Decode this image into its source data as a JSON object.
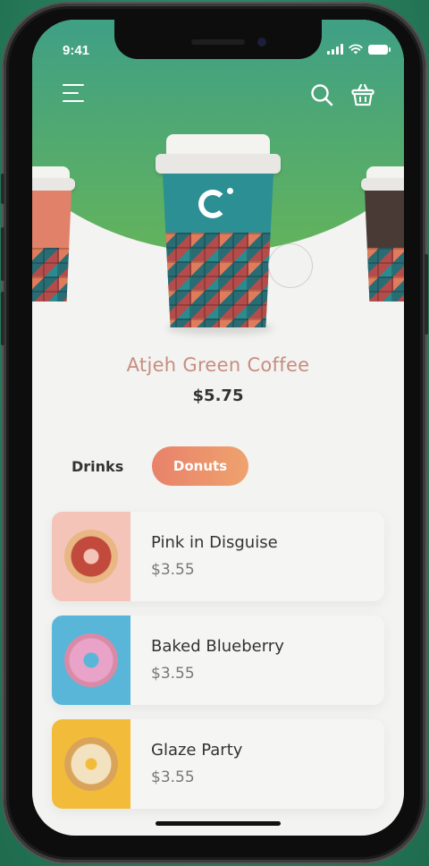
{
  "status_bar": {
    "time": "9:41"
  },
  "header": {
    "menu_icon": "menu-icon",
    "search_icon": "search-icon",
    "cart_icon": "basket-icon"
  },
  "featured": {
    "name": "Atjeh Green Coffee",
    "price": "$5.75"
  },
  "tabs": [
    {
      "label": "Drinks",
      "active": false
    },
    {
      "label": "Donuts",
      "active": true
    }
  ],
  "items": [
    {
      "name": "Pink in Disguise",
      "price": "$3.55",
      "thumb_color": "#f4c4b8"
    },
    {
      "name": "Baked Blueberry",
      "price": "$3.55",
      "thumb_color": "#5ab6d8"
    },
    {
      "name": "Glaze Party",
      "price": "$3.55",
      "thumb_color": "#f2bc3a"
    }
  ],
  "colors": {
    "accent": "#e8826a",
    "hero_green": "#4aa978",
    "title_rose": "#c88d7f"
  }
}
